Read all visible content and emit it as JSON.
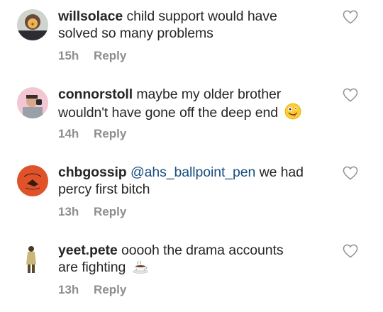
{
  "comments": [
    {
      "username": "willsolace",
      "text_line1": "child support would have",
      "text_line2": "solved so many problems",
      "time": "15h",
      "reply_label": "Reply",
      "avatar_icon": "avatar-willsolace"
    },
    {
      "username": "connorstoll",
      "text_line1": "maybe my older brother",
      "text_line2": "wouldn't have gone off the deep end",
      "emoji": "zany-face",
      "time": "14h",
      "reply_label": "Reply",
      "avatar_icon": "avatar-connorstoll"
    },
    {
      "username": "chbgossip",
      "mention": "@ahs_ballpoint_pen",
      "text_line1": "we had",
      "text_line2": "percy first bitch",
      "time": "13h",
      "reply_label": "Reply",
      "avatar_icon": "avatar-chbgossip"
    },
    {
      "username": "yeet.pete",
      "text_line1": "ooooh the drama accounts",
      "text_line2": "are fighting",
      "emoji": "hot-beverage",
      "time": "13h",
      "reply_label": "Reply",
      "avatar_icon": "avatar-yeetpete"
    }
  ],
  "colors": {
    "username": "#262626",
    "meta": "#8e8e8e",
    "mention": "#1a4e80",
    "heart_stroke": "#8e8e8e"
  }
}
